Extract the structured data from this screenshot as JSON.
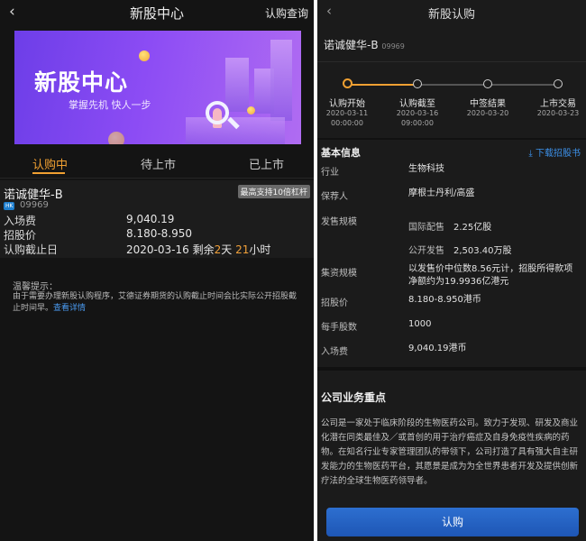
{
  "left": {
    "header": {
      "back": "‹",
      "title": "新股中心",
      "action": "认购查询"
    },
    "banner": {
      "title": "新股中心",
      "subtitle": "掌握先机 快人一步"
    },
    "tabs": [
      "认购中",
      "待上市",
      "已上市"
    ],
    "stock": {
      "name": "诺诚健华-B",
      "badge": "最高支持10倍杠杆",
      "market": "HK",
      "code": "09969",
      "entry_fee_label": "入场费",
      "entry_fee": "9,040.19",
      "price_label": "招股价",
      "price": "8.180-8.950",
      "deadline_label": "认购截止日",
      "deadline_date": "2020-03-16",
      "remain_prefix": "剩余",
      "remain_days": "2",
      "day_unit": "天",
      "remain_hours": "21",
      "hour_unit": "小时"
    },
    "hint": {
      "title": "温馨提示：",
      "body": "由于需要办理新股认购程序，艾德证券期货的认购截止时间会比实际公开招股截止时间早。",
      "link": "查看详情"
    }
  },
  "right": {
    "header": {
      "back": "‹",
      "title": "新股认购"
    },
    "stock_name": "诺诚健华-B",
    "stock_code": "09969",
    "timeline": [
      {
        "label": "认购开始",
        "date": "2020-03-11",
        "time": "00:00:00"
      },
      {
        "label": "认购截至",
        "date": "2020-03-16",
        "time": "09:00:00"
      },
      {
        "label": "中签结果",
        "date": "2020-03-20"
      },
      {
        "label": "上市交易",
        "date": "2020-03-23"
      }
    ],
    "timeline_progress": 0.25,
    "basic_title": "基本信息",
    "download": "下载招股书",
    "info": {
      "industry_label": "行业",
      "industry": "生物科技",
      "sponsor_label": "保荐人",
      "sponsor": "摩根士丹利/高盛",
      "scale_label": "发售规模",
      "intl_label": "国际配售",
      "intl": "2.25亿股",
      "public_label": "公开发售",
      "public": "2,503.40万股",
      "raise_label": "集资规模",
      "raise": "以发售价中位数8.56元计，招股所得款项净额约为19.9936亿港元",
      "price_label": "招股价",
      "price": "8.180-8.950港币",
      "lot_label": "每手股数",
      "lot": "1000",
      "fee_label": "入场费",
      "fee": "9,040.19港币"
    },
    "biz_title": "公司业务重点",
    "biz_body": "公司是一家处于临床阶段的生物医药公司。致力于发现、研发及商业化潜在同类最佳及／或首创的用于治疗癌症及自身免疫性疾病的药物。在知名行业专家管理团队的带领下，公司打造了具有强大自主研发能力的生物医药平台，其愿景是成为为全世界患者开发及提供创新疗法的全球生物医药领导者。",
    "submit": "认购"
  },
  "colors": {
    "accent": "#f0a032",
    "link": "#3c90e8",
    "button": "#2462c4",
    "banner": "#7b45ee"
  }
}
